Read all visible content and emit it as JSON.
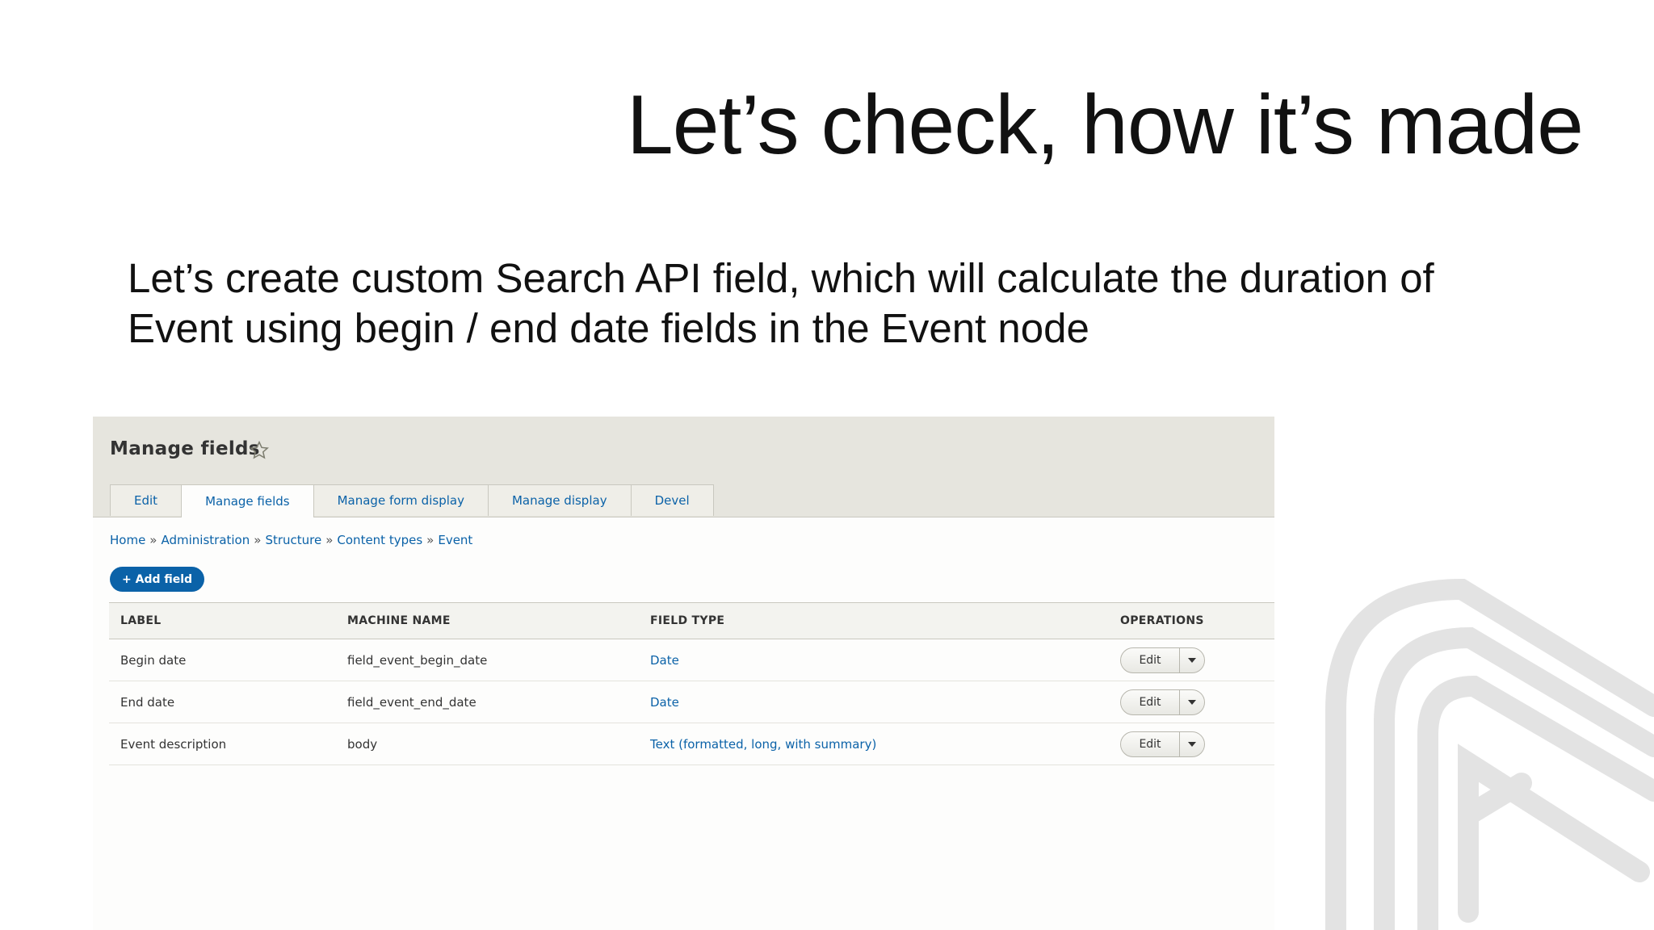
{
  "slide": {
    "title": "Let’s check, how it’s made",
    "body_line1": "Let’s create custom Search API  field, which will calculate the duration of",
    "body_line2": "Event using begin / end date fields in the Event node"
  },
  "screenshot": {
    "page_title": "Manage fields",
    "tabs": [
      {
        "label": "Edit",
        "active": false
      },
      {
        "label": "Manage fields",
        "active": true
      },
      {
        "label": "Manage form display",
        "active": false
      },
      {
        "label": "Manage display",
        "active": false
      },
      {
        "label": "Devel",
        "active": false
      }
    ],
    "breadcrumb": [
      "Home",
      "Administration",
      "Structure",
      "Content types",
      "Event"
    ],
    "breadcrumb_separator": "»",
    "add_field_label": "+ Add field",
    "table": {
      "headers": [
        "LABEL",
        "MACHINE NAME",
        "FIELD TYPE",
        "OPERATIONS"
      ],
      "rows": [
        {
          "label": "Begin date",
          "machine_name": "field_event_begin_date",
          "field_type": "Date",
          "operation": "Edit"
        },
        {
          "label": "End date",
          "machine_name": "field_event_end_date",
          "field_type": "Date",
          "operation": "Edit"
        },
        {
          "label": "Event description",
          "machine_name": "body",
          "field_type": "Text (formatted, long, with summary)",
          "operation": "Edit"
        }
      ]
    }
  },
  "colors": {
    "link": "#0b62a8",
    "header_bg": "#e6e5de",
    "logo": "#e3e3e3"
  },
  "icons": [
    "star-icon",
    "chevron-down-icon",
    "brand-logo"
  ]
}
